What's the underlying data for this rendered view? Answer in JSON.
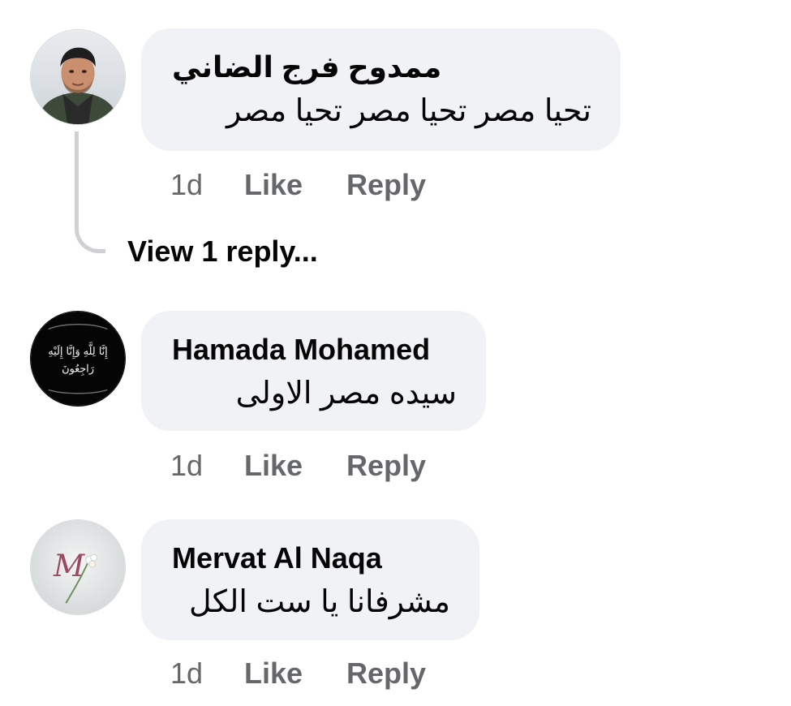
{
  "comments": [
    {
      "author": "ممدوح فرج الضاني",
      "text": "تحيا مصر تحيا مصر تحيا مصر",
      "avatar": "man-portrait-avatar",
      "time": "1d",
      "like_label": "Like",
      "reply_label": "Reply",
      "view_replies": "View 1 reply..."
    },
    {
      "author": "Hamada Mohamed",
      "text": "سيده مصر الاولى",
      "avatar": "black-condolence-calligraphy-avatar",
      "avatar_calligraphy": [
        "إِنَّا لِلَّهِ وَإِنَّا إِلَيْهِ",
        "رَاجِعُونَ"
      ],
      "time": "1d",
      "like_label": "Like",
      "reply_label": "Reply"
    },
    {
      "author": "Mervat Al Naqa",
      "text": "مشرفانا يا ست الكل",
      "avatar": "letter-m-flower-avatar",
      "avatar_letter": "M",
      "time": "1d",
      "like_label": "Like",
      "reply_label": "Reply"
    }
  ],
  "colors": {
    "bubble_bg": "#f0f2f5",
    "secondary_text": "#65676b",
    "primary_text": "#050505",
    "thread_line": "#ced0d4"
  }
}
